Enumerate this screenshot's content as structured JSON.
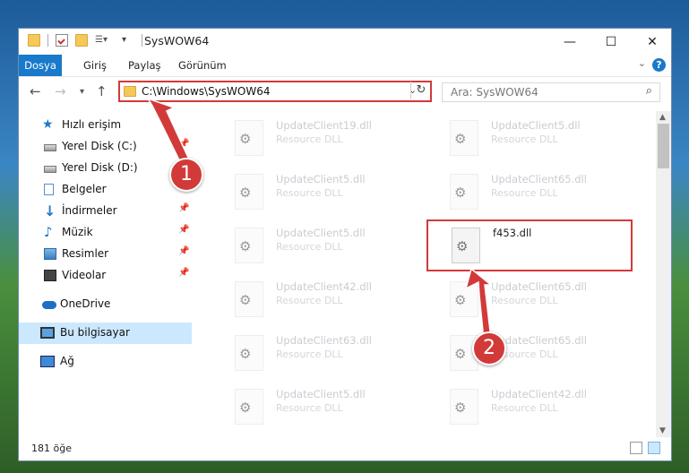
{
  "window": {
    "title": "SysWOW64",
    "minimize": "—",
    "maximize": "☐",
    "close": "✕"
  },
  "ribbon": {
    "tabs": [
      "Dosya",
      "Giriş",
      "Paylaş",
      "Görünüm"
    ],
    "help": "?",
    "collapse": "⌄"
  },
  "address": {
    "path": "C:\\Windows\\SysWOW64",
    "search_placeholder": "Ara: SysWOW64"
  },
  "sidebar": {
    "items": [
      {
        "label": "Hızlı erişim"
      },
      {
        "label": "Yerel Disk (C:)"
      },
      {
        "label": "Yerel Disk (D:)"
      },
      {
        "label": "Belgeler"
      },
      {
        "label": "İndirmeler"
      },
      {
        "label": "Müzik"
      },
      {
        "label": "Resimler"
      },
      {
        "label": "Videolar"
      },
      {
        "label": "OneDrive"
      },
      {
        "label": "Bu bilgisayar"
      },
      {
        "label": "Ağ"
      }
    ]
  },
  "files": [
    {
      "name": "UpdateClient19.dll",
      "type": "Resource DLL"
    },
    {
      "name": "UpdateClient5.dll",
      "type": "Resource DLL"
    },
    {
      "name": "UpdateClient5.dll",
      "type": "Resource DLL"
    },
    {
      "name": "UpdateClient65.dll",
      "type": "Resource DLL"
    },
    {
      "name": "UpdateClient5.dll",
      "type": "Resource DLL"
    },
    {
      "name": "f453.dll",
      "type": ""
    },
    {
      "name": "UpdateClient42.dll",
      "type": "Resource DLL"
    },
    {
      "name": "UpdateClient65.dll",
      "type": "Resource DLL"
    },
    {
      "name": "UpdateClient63.dll",
      "type": "Resource DLL"
    },
    {
      "name": "UpdateClient65.dll",
      "type": "Resource DLL"
    },
    {
      "name": "UpdateClient5.dll",
      "type": "Resource DLL"
    },
    {
      "name": "UpdateClient42.dll",
      "type": "Resource DLL"
    }
  ],
  "status": {
    "item_count": "181 öğe"
  },
  "annotations": {
    "badge1": "1",
    "badge2": "2",
    "color": "#d23a3a"
  }
}
